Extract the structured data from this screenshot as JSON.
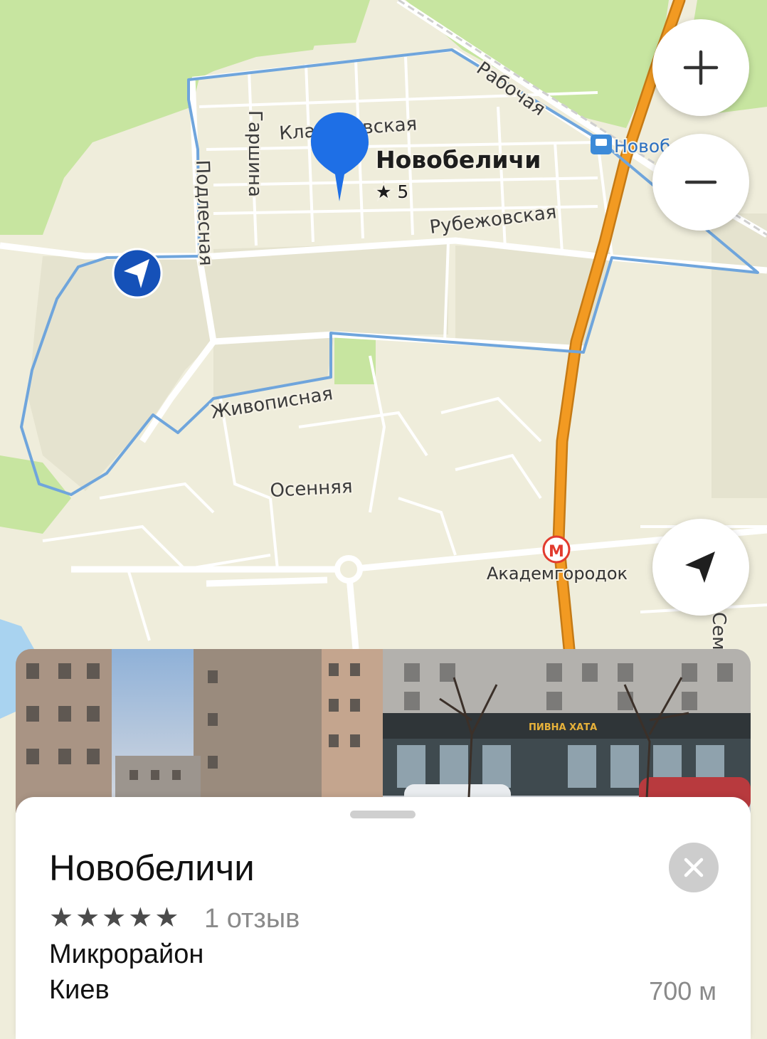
{
  "map": {
    "streets": {
      "rabochaya": "Рабочая",
      "klavdievskaya": "Клавдиевская",
      "garshina": "Гаршина",
      "podlesnaya": "Подлесная",
      "rubezhovskaya": "Рубежовская",
      "zhivopisnaya": "Живописная",
      "osennyaya": "Осенняя",
      "sem": "Сем"
    },
    "pin": {
      "title": "Новобеличи",
      "rating": "★ 5"
    },
    "stations": {
      "rail": "Новобеличи",
      "metro": "Академгородок",
      "metro_symbol": "М"
    },
    "colors": {
      "land": "#efeddb",
      "park": "#c7e5a0",
      "highway": "#f29a22",
      "boundary": "#6fa5dc",
      "pin": "#1e6fe6",
      "location": "#1551b8"
    }
  },
  "controls": {
    "zoom_in_icon": "plus-icon",
    "zoom_out_icon": "minus-icon",
    "locate_icon": "navigation-arrow-icon"
  },
  "card": {
    "title": "Новобеличи",
    "stars": [
      "★",
      "★",
      "★",
      "★",
      "★"
    ],
    "rating_value": 5,
    "reviews": "1 отзыв",
    "category": "Микрорайон",
    "city": "Киев",
    "distance": "700 м",
    "shop_sign": "ПИВНА ХАТА"
  }
}
